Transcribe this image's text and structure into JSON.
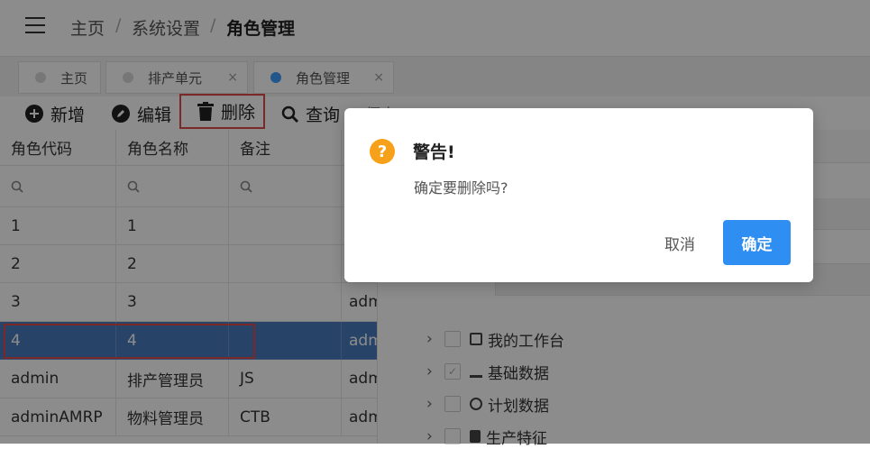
{
  "breadcrumb": {
    "home": "主页",
    "sep": "/",
    "level2": "系统设置",
    "current": "角色管理"
  },
  "tabs": [
    {
      "label": "主页",
      "closable": false,
      "active": false
    },
    {
      "label": "排产单元",
      "closable": true,
      "active": false
    },
    {
      "label": "角色管理",
      "closable": true,
      "active": true
    }
  ],
  "tab_close_glyph": "×",
  "toolbar": {
    "add": "新增",
    "edit": "编辑",
    "delete": "删除",
    "query": "查询",
    "partial": "保存"
  },
  "table": {
    "headers": [
      "角色代码",
      "角色名称",
      "备注"
    ],
    "rows": [
      [
        "1",
        "1",
        "",
        ""
      ],
      [
        "2",
        "2",
        "",
        ""
      ],
      [
        "3",
        "3",
        "",
        "adm"
      ],
      [
        "4",
        "4",
        "",
        "adm"
      ],
      [
        "admin",
        "排产管理员",
        "JS",
        "adm"
      ],
      [
        "adminAMRP",
        "物料管理员",
        "CTB",
        "adm"
      ]
    ],
    "selected_row": 3
  },
  "tree": [
    {
      "label": "我的工作台",
      "icon": "workbench-icon"
    },
    {
      "label": "基础数据",
      "icon": "chart-icon"
    },
    {
      "label": "计划数据",
      "icon": "timer-icon"
    },
    {
      "label": "生产特征",
      "icon": "clipboard-icon"
    }
  ],
  "dialog": {
    "icon_glyph": "?",
    "title": "警告!",
    "message": "确定要删除吗?",
    "cancel": "取消",
    "confirm": "确定"
  },
  "colors": {
    "primary": "#2f8ef1",
    "warning": "#f7a11a",
    "selected_row": "#4a7bbd",
    "highlight_border": "#e04a4a"
  }
}
